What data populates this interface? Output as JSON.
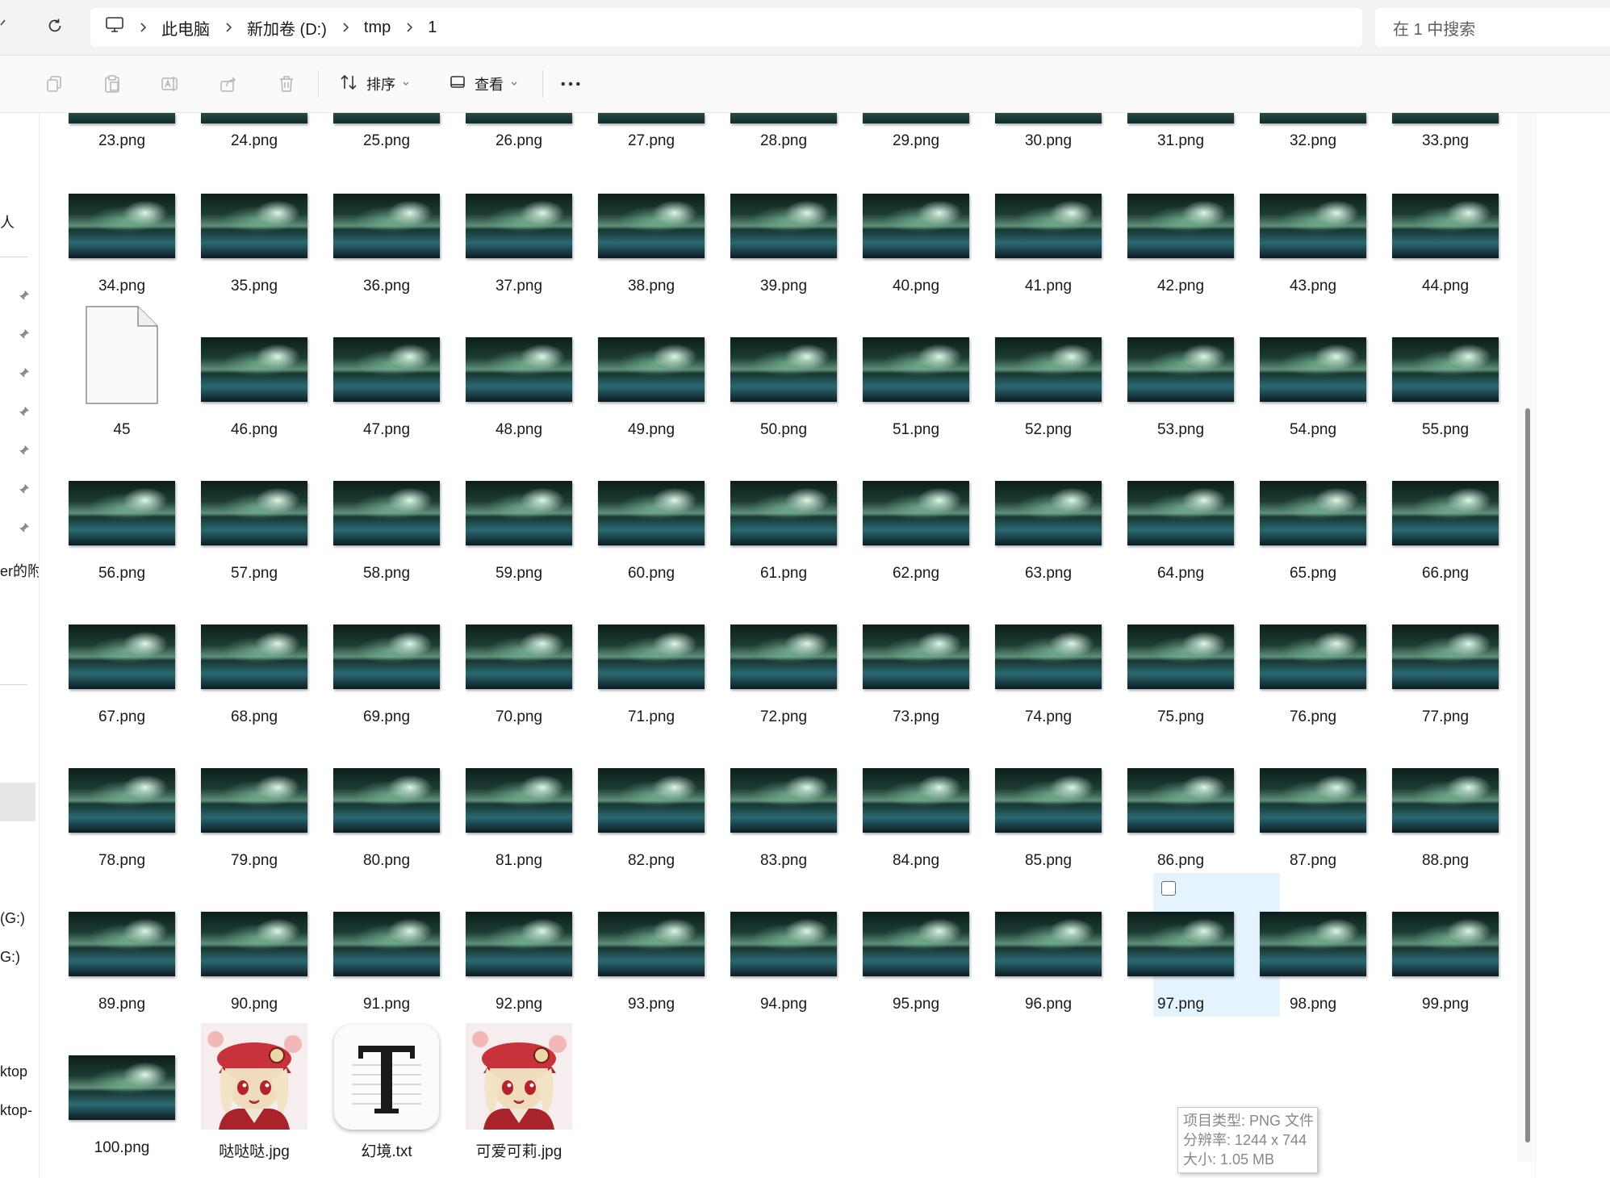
{
  "breadcrumb": {
    "items": [
      "此电脑",
      "新加卷 (D:)",
      "tmp",
      "1"
    ]
  },
  "search": {
    "placeholder": "在 1 中搜索"
  },
  "toolbar": {
    "sort_label": "排序",
    "view_label": "查看"
  },
  "sidebar": {
    "texts": [
      "人",
      "er的附",
      "(G:)",
      "G:)",
      "ktop",
      "ktop-"
    ]
  },
  "files": {
    "row_top_partial": [
      "23.png",
      "24.png",
      "25.png",
      "26.png",
      "27.png",
      "28.png",
      "29.png",
      "30.png",
      "31.png",
      "32.png",
      "33.png"
    ],
    "row_1": [
      "34.png",
      "35.png",
      "36.png",
      "37.png",
      "38.png",
      "39.png",
      "40.png",
      "41.png",
      "42.png",
      "43.png",
      "44.png"
    ],
    "row_2": [
      "45",
      "46.png",
      "47.png",
      "48.png",
      "49.png",
      "50.png",
      "51.png",
      "52.png",
      "53.png",
      "54.png",
      "55.png"
    ],
    "row_3": [
      "56.png",
      "57.png",
      "58.png",
      "59.png",
      "60.png",
      "61.png",
      "62.png",
      "63.png",
      "64.png",
      "65.png",
      "66.png"
    ],
    "row_4": [
      "67.png",
      "68.png",
      "69.png",
      "70.png",
      "71.png",
      "72.png",
      "73.png",
      "74.png",
      "75.png",
      "76.png",
      "77.png"
    ],
    "row_5": [
      "78.png",
      "79.png",
      "80.png",
      "81.png",
      "82.png",
      "83.png",
      "84.png",
      "85.png",
      "86.png",
      "87.png",
      "88.png"
    ],
    "row_6": [
      "89.png",
      "90.png",
      "91.png",
      "92.png",
      "93.png",
      "94.png",
      "95.png",
      "96.png",
      "97.png",
      "98.png",
      "99.png"
    ],
    "row_7": [
      "100.png",
      "哒哒哒.jpg",
      "幻境.txt",
      "可爱可莉.jpg"
    ]
  },
  "tooltip": {
    "type": "项目类型: PNG 文件",
    "resolution": "分辨率: 1244 x 744",
    "size": "大小: 1.05 MB"
  },
  "colors": {
    "hover_bg": "#e5f3ff",
    "toolbar_bg": "#fafafa",
    "address_bar_bg": "#f3f3f3"
  }
}
